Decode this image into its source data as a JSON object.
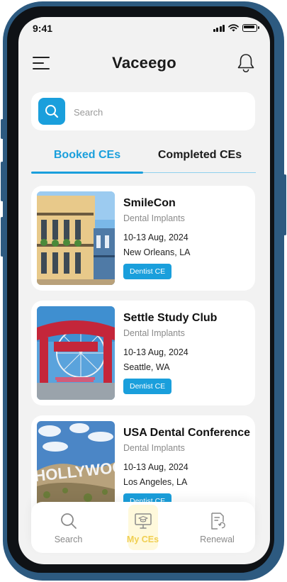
{
  "status_bar": {
    "time": "9:41"
  },
  "header": {
    "title": "Vaceego"
  },
  "search": {
    "placeholder": "Search"
  },
  "tabs": [
    {
      "label": "Booked CEs",
      "active": true
    },
    {
      "label": "Completed CEs",
      "active": false
    }
  ],
  "events": [
    {
      "title": "SmileCon",
      "category": "Dental Implants",
      "date": "10-13 Aug, 2024",
      "location": "New Orleans, LA",
      "badge": "Dentist CE"
    },
    {
      "title": "Settle Study Club",
      "category": "Dental Implants",
      "date": "10-13 Aug, 2024",
      "location": "Seattle, WA",
      "badge": "Dentist CE"
    },
    {
      "title": "USA Dental Conference",
      "category": "Dental Implants",
      "date": "10-13 Aug, 2024",
      "location": "Los Angeles, LA",
      "badge": "Dentist CE",
      "image_text": "HOLLYWOOD"
    }
  ],
  "bottom_nav": [
    {
      "label": "Search",
      "icon": "search-icon",
      "active": false
    },
    {
      "label": "My CEs",
      "icon": "monitor-graduation-icon",
      "active": true
    },
    {
      "label": "Renewal",
      "icon": "document-refresh-icon",
      "active": false
    }
  ],
  "colors": {
    "accent": "#1a9fdc",
    "active_nav": "#f0cf52",
    "phone_frame": "#2d5a80",
    "screen_bg": "#f2f2f2"
  }
}
